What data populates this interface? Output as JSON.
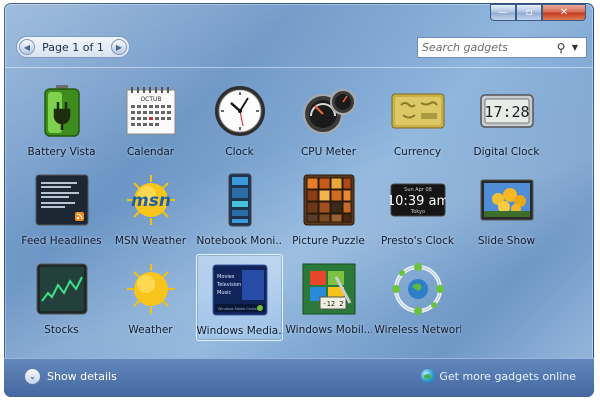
{
  "window": {
    "min_glyph": "—",
    "max_glyph": "▫",
    "close_glyph": "✕"
  },
  "pager": {
    "prev_glyph": "◀",
    "label": "Page 1 of 1",
    "next_glyph": "▶"
  },
  "search": {
    "placeholder": "Search gadgets",
    "search_glyph": "⚲",
    "drop_glyph": "▼"
  },
  "gadgets": [
    {
      "label": "Battery Vista",
      "icon": "battery-icon"
    },
    {
      "label": "Calendar",
      "icon": "calendar-icon",
      "month": "OCTUB"
    },
    {
      "label": "Clock",
      "icon": "clock-icon"
    },
    {
      "label": "CPU Meter",
      "icon": "cpu-meter-icon"
    },
    {
      "label": "Currency",
      "icon": "currency-icon"
    },
    {
      "label": "Digital Clock",
      "icon": "digital-clock-icon",
      "time": "17:28"
    },
    {
      "label": "Feed Headlines",
      "icon": "feed-headlines-icon"
    },
    {
      "label": "MSN Weather",
      "icon": "msn-weather-icon",
      "logo": "msn"
    },
    {
      "label": "Notebook Moni...",
      "icon": "notebook-monitor-icon"
    },
    {
      "label": "Picture Puzzle",
      "icon": "picture-puzzle-icon"
    },
    {
      "label": "Presto's Clock",
      "icon": "prestos-clock-icon",
      "date": "Sun Apr 08",
      "time": "10:39 am",
      "city": "Tokyo"
    },
    {
      "label": "Slide Show",
      "icon": "slide-show-icon"
    },
    {
      "label": "Stocks",
      "icon": "stocks-icon"
    },
    {
      "label": "Weather",
      "icon": "weather-icon"
    },
    {
      "label": "Windows Media...",
      "icon": "windows-media-center-icon",
      "selected": true,
      "menu": [
        "Movies",
        "Television",
        "Music"
      ],
      "footer": "Windows Media Center"
    },
    {
      "label": "Windows Mobil...",
      "icon": "windows-mobile-icon",
      "readout": "-12 2"
    },
    {
      "label": "Wireless Network",
      "icon": "wireless-network-icon"
    }
  ],
  "footer": {
    "show_details_glyph": "⌄",
    "show_details": "Show details",
    "get_more": "Get more gadgets online"
  },
  "colors": {
    "window": "#7aa0cf",
    "bottombar": "#4e74aa",
    "selected": "#d8eaff"
  }
}
